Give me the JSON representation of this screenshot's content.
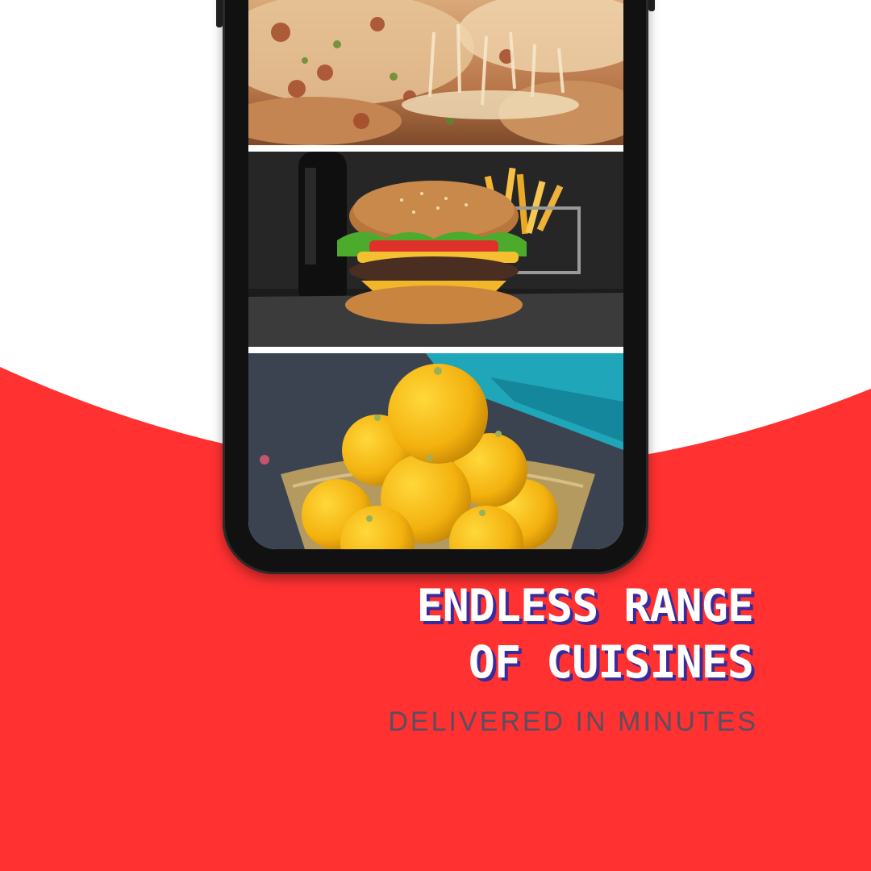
{
  "colors": {
    "background_top": "#ffffff",
    "background_red": "#ff3131",
    "headline_text": "#ffffff",
    "headline_shadow": "#3b2b9a",
    "tagline_text": "#5a4e60",
    "phone_frame": "#111111"
  },
  "phone": {
    "panels": [
      {
        "name": "pizza",
        "icon": "pizza-photo"
      },
      {
        "name": "burger",
        "icon": "burger-photo"
      },
      {
        "name": "ladoo",
        "icon": "ladoo-photo"
      }
    ]
  },
  "headline": {
    "line1": "ENDLESS RANGE",
    "line2": "OF CUISINES"
  },
  "tagline": "DELIVERED IN MINUTES"
}
